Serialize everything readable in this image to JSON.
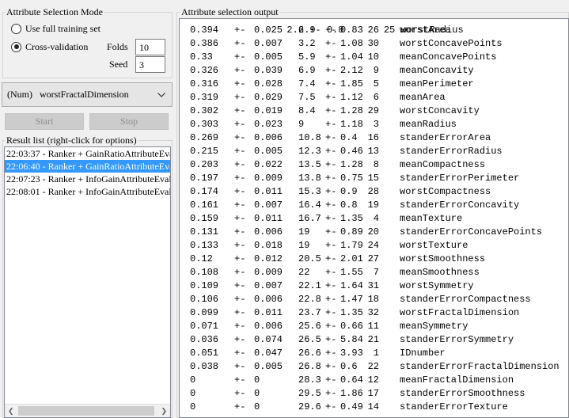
{
  "attribute_selection_mode": {
    "title": "Attribute Selection Mode",
    "options": [
      {
        "label": "Use full training set",
        "checked": false
      },
      {
        "label": "Cross-validation",
        "checked": true
      }
    ],
    "folds_label": "Folds",
    "folds_value": "10",
    "seed_label": "Seed",
    "seed_value": "3"
  },
  "class_selector": {
    "value": "(Num)   worstFractalDimension"
  },
  "buttons": {
    "start": "Start",
    "stop": "Stop"
  },
  "result_list": {
    "title": "Result list (right-click for options)",
    "items": [
      {
        "text": "22:03:37 - Ranker + GainRatioAttributeEval",
        "selected": false
      },
      {
        "text": "22:06:40 - Ranker + GainRatioAttributeEval",
        "selected": true
      },
      {
        "text": "22:07:23 - Ranker + InfoGainAttributeEval",
        "selected": false
      },
      {
        "text": "22:08:01 - Ranker + InfoGainAttributeEval",
        "selected": false
      }
    ]
  },
  "output": {
    "title": "Attribute selection output",
    "rows": [
      {
        "merit": "0.394",
        "merit_sd": "0.025",
        "rank": "2.9",
        "rank_sd": "0.83",
        "id": "26",
        "name": "worstArea"
      },
      {
        "merit": "0.386",
        "merit_sd": "0.007",
        "rank": "3.2",
        "rank_sd": "1.08",
        "id": "30",
        "name": "worstConcavePoints"
      },
      {
        "merit": "0.33",
        "merit_sd": "0.005",
        "rank": "5.9",
        "rank_sd": "1.04",
        "id": "10",
        "name": "meanConcavePoints"
      },
      {
        "merit": "0.326",
        "merit_sd": "0.039",
        "rank": "6.9",
        "rank_sd": "2.12",
        "id": "9",
        "name": "meanConcavity"
      },
      {
        "merit": "0.316",
        "merit_sd": "0.028",
        "rank": "7.4",
        "rank_sd": "1.85",
        "id": "5",
        "name": "meanPerimeter"
      },
      {
        "merit": "0.319",
        "merit_sd": "0.029",
        "rank": "7.5",
        "rank_sd": "1.12",
        "id": "6",
        "name": "meanArea"
      },
      {
        "merit": "0.302",
        "merit_sd": "0.019",
        "rank": "8.4",
        "rank_sd": "1.28",
        "id": "29",
        "name": "worstConcavity"
      },
      {
        "merit": "0.303",
        "merit_sd": "0.023",
        "rank": "9",
        "rank_sd": "1.18",
        "id": "3",
        "name": "meanRadius"
      },
      {
        "merit": "0.269",
        "merit_sd": "0.006",
        "rank": "10.8",
        "rank_sd": "0.4",
        "id": "16",
        "name": "standerErrorArea"
      },
      {
        "merit": "0.215",
        "merit_sd": "0.005",
        "rank": "12.3",
        "rank_sd": "0.46",
        "id": "13",
        "name": "standerErrorRadius"
      },
      {
        "merit": "0.203",
        "merit_sd": "0.022",
        "rank": "13.5",
        "rank_sd": "1.28",
        "id": "8",
        "name": "meanCompactness"
      },
      {
        "merit": "0.197",
        "merit_sd": "0.009",
        "rank": "13.8",
        "rank_sd": "0.75",
        "id": "15",
        "name": "standerErrorPerimeter"
      },
      {
        "merit": "0.174",
        "merit_sd": "0.011",
        "rank": "15.3",
        "rank_sd": "0.9",
        "id": "28",
        "name": "worstCompactness"
      },
      {
        "merit": "0.161",
        "merit_sd": "0.007",
        "rank": "16.4",
        "rank_sd": "0.8",
        "id": "19",
        "name": "standerErrorConcavity"
      },
      {
        "merit": "0.159",
        "merit_sd": "0.011",
        "rank": "16.7",
        "rank_sd": "1.35",
        "id": "4",
        "name": "meanTexture"
      },
      {
        "merit": "0.131",
        "merit_sd": "0.006",
        "rank": "19",
        "rank_sd": "0.89",
        "id": "20",
        "name": "standerErrorConcavePoints"
      },
      {
        "merit": "0.133",
        "merit_sd": "0.018",
        "rank": "19",
        "rank_sd": "1.79",
        "id": "24",
        "name": "worstTexture"
      },
      {
        "merit": "0.12",
        "merit_sd": "0.012",
        "rank": "20.5",
        "rank_sd": "2.01",
        "id": "27",
        "name": "worstSmoothness"
      },
      {
        "merit": "0.108",
        "merit_sd": "0.009",
        "rank": "22",
        "rank_sd": "1.55",
        "id": "7",
        "name": "meanSmoothness"
      },
      {
        "merit": "0.109",
        "merit_sd": "0.007",
        "rank": "22.1",
        "rank_sd": "1.64",
        "id": "31",
        "name": "worstSymmetry"
      },
      {
        "merit": "0.106",
        "merit_sd": "0.006",
        "rank": "22.8",
        "rank_sd": "1.47",
        "id": "18",
        "name": "standerErrorCompactness"
      },
      {
        "merit": "0.099",
        "merit_sd": "0.011",
        "rank": "23.7",
        "rank_sd": "1.35",
        "id": "32",
        "name": "worstFractalDimension"
      },
      {
        "merit": "0.071",
        "merit_sd": "0.006",
        "rank": "25.6",
        "rank_sd": "0.66",
        "id": "11",
        "name": "meanSymmetry"
      },
      {
        "merit": "0.036",
        "merit_sd": "0.074",
        "rank": "26.5",
        "rank_sd": "5.84",
        "id": "21",
        "name": "standerErrorSymmetry"
      },
      {
        "merit": "0.051",
        "merit_sd": "0.047",
        "rank": "26.6",
        "rank_sd": "3.93",
        "id": "1",
        "name": "IDnumber"
      },
      {
        "merit": "0.038",
        "merit_sd": "0.005",
        "rank": "26.8",
        "rank_sd": "0.6",
        "id": "22",
        "name": "standerErrorFractalDimension"
      },
      {
        "merit": "0",
        "merit_sd": "0",
        "rank": "28.3",
        "rank_sd": "0.64",
        "id": "12",
        "name": "meanFractalDimension"
      },
      {
        "merit": "0",
        "merit_sd": "0",
        "rank": "29.5",
        "rank_sd": "1.86",
        "id": "17",
        "name": "standerErrorSmoothness"
      },
      {
        "merit": "0",
        "merit_sd": "0",
        "rank": "29.6",
        "rank_sd": "0.49",
        "id": "14",
        "name": "standerErrorTexture"
      }
    ]
  }
}
